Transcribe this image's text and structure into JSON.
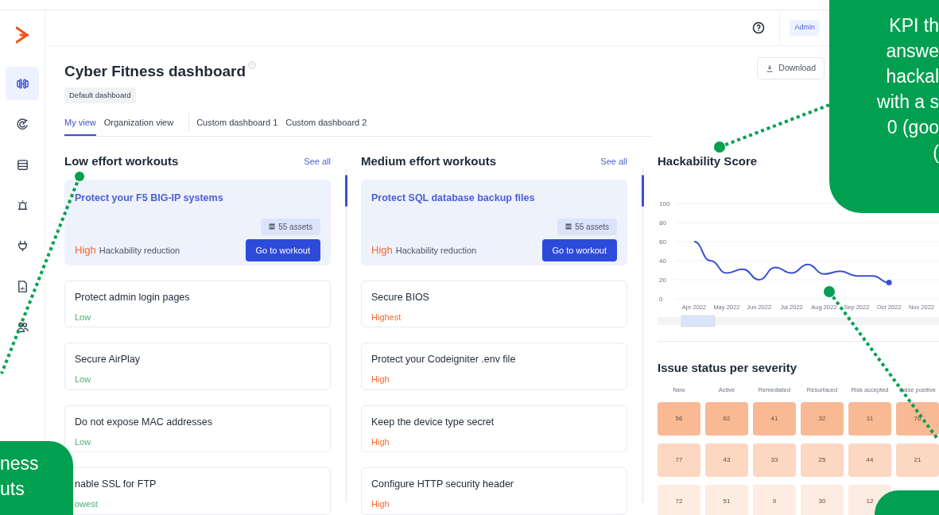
{
  "sidebar": {
    "items": [
      {
        "selected": true
      },
      {
        "selected": false
      },
      {
        "selected": false
      },
      {
        "selected": false
      },
      {
        "selected": false
      },
      {
        "selected": false
      },
      {
        "selected": false
      }
    ]
  },
  "top_bar": {
    "role_badge": "Admin"
  },
  "header": {
    "title": "Cyber Fitness dashboard",
    "tag": "Default dashboard",
    "download_button": "Download"
  },
  "tabs": [
    {
      "label": "My view",
      "selected": true,
      "kind": "view"
    },
    {
      "label": "Organization view",
      "selected": false,
      "kind": "view"
    },
    {
      "label": "Custom dashboard 1",
      "selected": false,
      "kind": "custom"
    },
    {
      "label": "Custom dashboard 2",
      "selected": false,
      "kind": "custom"
    }
  ],
  "workout_columns": [
    {
      "title": "Low effort workouts",
      "see_all": "See all",
      "featured": {
        "title": "Protect your F5 BIG-IP systems",
        "assets": "55 assets",
        "impact": "High",
        "impact_label": "Hackability reduction",
        "button": "Go to workout"
      },
      "items": [
        {
          "title": "Protect admin login pages",
          "impact": "Low",
          "kind": "low"
        },
        {
          "title": "Secure AirPlay",
          "impact": "Low",
          "kind": "low"
        },
        {
          "title": "Do not expose MAC addresses",
          "impact": "Low",
          "kind": "low"
        },
        {
          "title": "nable SSL for FTP",
          "impact": "owest",
          "kind": "low"
        }
      ]
    },
    {
      "title": "Medium effort workouts",
      "see_all": "See all",
      "featured": {
        "title": "Protect SQL database backup files",
        "assets": "55 assets",
        "impact": "High",
        "impact_label": "Hackability reduction",
        "button": "Go to workout"
      },
      "items": [
        {
          "title": "Secure BIOS",
          "impact": "Highest",
          "kind": "high"
        },
        {
          "title": "Protect your Codeigniter .env file",
          "impact": "High",
          "kind": "high"
        },
        {
          "title": "Keep the device type secret",
          "impact": "High",
          "kind": "high"
        },
        {
          "title": "Configure HTTP security header",
          "impact": "High",
          "kind": "high"
        }
      ]
    }
  ],
  "hackability": {
    "title": "Hackability Score",
    "chart_data": {
      "type": "line",
      "categories": [
        "Apr 2022",
        null,
        "May 2022",
        null,
        "Jun 2022",
        null,
        "Jul 2022",
        null,
        "Aug 2022",
        null,
        "Sep 2022",
        null,
        "Oct 2022",
        null,
        "Nov 2022"
      ],
      "series": [
        {
          "color": "#3b4fd4",
          "values": [
            60,
            40,
            27,
            31,
            20,
            33,
            27,
            36,
            26,
            29,
            24,
            24,
            17,
            null,
            null
          ]
        }
      ],
      "ylim": [
        0,
        100
      ],
      "grid": true,
      "yticks": [
        0,
        20,
        40,
        60,
        80,
        100
      ]
    }
  },
  "issue_status": {
    "title": "Issue status per severity",
    "columns": [
      "New",
      "Active",
      "Remediated",
      "Resurfaced",
      "Risk accepted",
      "False positive"
    ],
    "rows": [
      {
        "color": "#f9b995",
        "cells": [
          "56",
          "62",
          "41",
          "32",
          "11",
          "76"
        ]
      },
      {
        "color": "#fcd7c1",
        "cells": [
          "77",
          "43",
          "33",
          "25",
          "44",
          "21"
        ]
      },
      {
        "color": "#fdece2",
        "cells": [
          "72",
          "51",
          "9",
          "30",
          "12"
        ]
      }
    ]
  },
  "callouts": [
    {
      "kind": "top",
      "lines": [
        "KPI th",
        "answe",
        "hackal",
        "with a s",
        "0 (goo",
        "("
      ]
    },
    {
      "kind": "left",
      "lines": [
        "ness",
        "uts"
      ]
    },
    {
      "kind": "bottom"
    }
  ]
}
